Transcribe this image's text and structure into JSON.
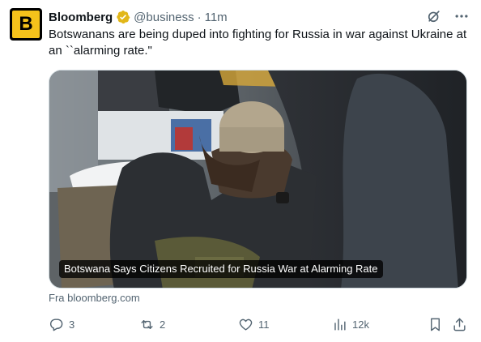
{
  "tweet": {
    "display_name": "Bloomberg",
    "handle": "@business",
    "separator": "·",
    "time": "11m",
    "text": "Botswanans are being duped into fighting for Russia in war against Ukraine at an ``alarming rate.\"",
    "avatar_letter": "B",
    "card": {
      "headline": "Botswana Says Citizens Recruited for Russia War at Alarming Rate",
      "source": "Fra bloomberg.com"
    },
    "metrics": {
      "replies": "3",
      "reposts": "2",
      "likes": "11",
      "views": "12k"
    }
  },
  "icons": {
    "verified": "verified-badge-icon",
    "grok": "grok-icon",
    "more": "more-icon",
    "reply": "reply-icon",
    "repost": "repost-icon",
    "like": "like-icon",
    "views": "views-icon",
    "bookmark": "bookmark-icon",
    "share": "share-icon"
  },
  "colors": {
    "text": "#0f1419",
    "secondary": "#536471",
    "avatar_bg": "#000000",
    "avatar_fg": "#f5c21b",
    "verified": "#e2b719"
  }
}
